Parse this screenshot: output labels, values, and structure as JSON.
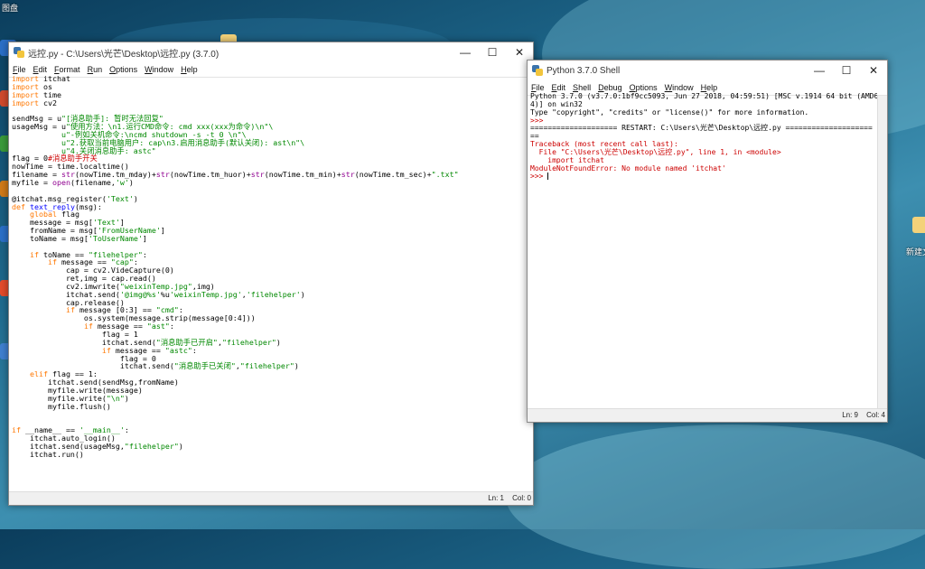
{
  "editor": {
    "title": "远控.py - C:\\Users\\光芒\\Desktop\\远控.py (3.7.0)",
    "menu": [
      "File",
      "Edit",
      "Format",
      "Run",
      "Options",
      "Window",
      "Help"
    ],
    "status_line": "Ln: 1",
    "status_col": "Col: 0",
    "code_lines": [
      [
        [
          "kw",
          "import"
        ],
        [
          "",
          " itchat"
        ]
      ],
      [
        [
          "kw",
          "import"
        ],
        [
          "",
          " os"
        ]
      ],
      [
        [
          "kw",
          "import"
        ],
        [
          "",
          " time"
        ]
      ],
      [
        [
          "kw",
          "import"
        ],
        [
          "",
          " cv2"
        ]
      ],
      [
        [
          "",
          ""
        ]
      ],
      [
        [
          "",
          "sendMsg = u"
        ],
        [
          "st",
          "\"[消息助手]: 暂时无法回复\""
        ]
      ],
      [
        [
          "",
          "usageMsg = u"
        ],
        [
          "st",
          "\"使用方法：\\n1.运行CMD命令: cmd xxx(xxx为命令)\\n\"\\"
        ]
      ],
      [
        [
          "st",
          "           u\"-例如关机命令:\\ncmd shutdown -s -t 0 \\n\"\\"
        ]
      ],
      [
        [
          "st",
          "           u\"2.获取当前电脑用户: cap\\n3.启用消息助手(默认关闭): ast\\n\"\\"
        ]
      ],
      [
        [
          "st",
          "           u\"4.关闭消息助手: astc\""
        ]
      ],
      [
        [
          "",
          "flag = 0"
        ],
        [
          "er",
          "#消息助手开关"
        ]
      ],
      [
        [
          "",
          "nowTime = time.localtime()"
        ]
      ],
      [
        [
          "",
          "filename = "
        ],
        [
          "bi",
          "str"
        ],
        [
          "",
          "(nowTime.tm_mday)+"
        ],
        [
          "bi",
          "str"
        ],
        [
          "",
          "(nowTime.tm_huor)+"
        ],
        [
          "bi",
          "str"
        ],
        [
          "",
          "(nowTime.tm_min)+"
        ],
        [
          "bi",
          "str"
        ],
        [
          "",
          "(nowTime.tm_sec)+"
        ],
        [
          "st",
          "\".txt\""
        ]
      ],
      [
        [
          "",
          "myfile = "
        ],
        [
          "bi",
          "open"
        ],
        [
          "",
          "(filename,"
        ],
        [
          "st",
          "'w'"
        ],
        [
          "",
          ")"
        ]
      ],
      [
        [
          "",
          ""
        ]
      ],
      [
        [
          "",
          "@itchat.msg_register("
        ],
        [
          "st",
          "'Text'"
        ],
        [
          "",
          ")"
        ]
      ],
      [
        [
          "kw",
          "def"
        ],
        [
          "",
          " "
        ],
        [
          "fn",
          "text_reply"
        ],
        [
          "",
          "(msg):"
        ]
      ],
      [
        [
          "",
          "    "
        ],
        [
          "kw",
          "global"
        ],
        [
          "",
          " flag"
        ]
      ],
      [
        [
          "",
          "    message = msg["
        ],
        [
          "st",
          "'Text'"
        ],
        [
          "",
          "]"
        ]
      ],
      [
        [
          "",
          "    fromName = msg["
        ],
        [
          "st",
          "'FromUserName'"
        ],
        [
          "",
          "]"
        ]
      ],
      [
        [
          "",
          "    toName = msg["
        ],
        [
          "st",
          "'ToUserName'"
        ],
        [
          "",
          "]"
        ]
      ],
      [
        [
          "",
          ""
        ]
      ],
      [
        [
          "",
          "    "
        ],
        [
          "kw",
          "if"
        ],
        [
          "",
          " toName == "
        ],
        [
          "st",
          "\"filehelper\""
        ],
        [
          "",
          ":"
        ]
      ],
      [
        [
          "",
          "        "
        ],
        [
          "kw",
          "if"
        ],
        [
          "",
          " message == "
        ],
        [
          "st",
          "\"cap\""
        ],
        [
          "",
          ":"
        ]
      ],
      [
        [
          "",
          "            cap = cv2.VideCapture(0)"
        ]
      ],
      [
        [
          "",
          "            ret,img = cap.read()"
        ]
      ],
      [
        [
          "",
          "            cv2.imwrite("
        ],
        [
          "st",
          "\"weixinTemp.jpg\""
        ],
        [
          "",
          ",img)"
        ]
      ],
      [
        [
          "",
          "            itchat.send("
        ],
        [
          "st",
          "'@img@%s'"
        ],
        [
          "",
          "%u"
        ],
        [
          "st",
          "'weixinTemp.jpg'"
        ],
        [
          "",
          ","
        ],
        [
          "st",
          "'filehelper'"
        ],
        [
          "",
          ")"
        ]
      ],
      [
        [
          "",
          "            cap.release()"
        ]
      ],
      [
        [
          "",
          "            "
        ],
        [
          "kw",
          "if"
        ],
        [
          "",
          " message [0:3] == "
        ],
        [
          "st",
          "\"cmd\""
        ],
        [
          "",
          ":"
        ]
      ],
      [
        [
          "",
          "                os.system(message.strip(message[0:4]))"
        ]
      ],
      [
        [
          "",
          "                "
        ],
        [
          "kw",
          "if"
        ],
        [
          "",
          " message == "
        ],
        [
          "st",
          "\"ast\""
        ],
        [
          "",
          ":"
        ]
      ],
      [
        [
          "",
          "                    flag = 1"
        ]
      ],
      [
        [
          "",
          "                    itchat.send("
        ],
        [
          "st",
          "\"消息助手已开启\""
        ],
        [
          "",
          ","
        ],
        [
          "st",
          "\"filehelper\""
        ],
        [
          "",
          ")"
        ]
      ],
      [
        [
          "",
          "                    "
        ],
        [
          "kw",
          "if"
        ],
        [
          "",
          " message == "
        ],
        [
          "st",
          "\"astc\""
        ],
        [
          "",
          ":"
        ]
      ],
      [
        [
          "",
          "                        flag = 0"
        ]
      ],
      [
        [
          "",
          "                        itchat.send("
        ],
        [
          "st",
          "\"消息助手已关闭\""
        ],
        [
          "",
          ","
        ],
        [
          "st",
          "\"filehelper\""
        ],
        [
          "",
          ")"
        ]
      ],
      [
        [
          "",
          "    "
        ],
        [
          "kw",
          "elif"
        ],
        [
          "",
          " flag == 1:"
        ]
      ],
      [
        [
          "",
          "        itchat.send(sendMsg,fromName)"
        ]
      ],
      [
        [
          "",
          "        myfile.write(message)"
        ]
      ],
      [
        [
          "",
          "        myfile.write("
        ],
        [
          "st",
          "\"\\n\""
        ],
        [
          "",
          ")"
        ]
      ],
      [
        [
          "",
          "        myfile.flush()"
        ]
      ],
      [
        [
          "",
          ""
        ]
      ],
      [
        [
          "",
          ""
        ]
      ],
      [
        [
          "kw",
          "if"
        ],
        [
          "",
          " __name__ == "
        ],
        [
          "st",
          "'__main__'"
        ],
        [
          "",
          ":"
        ]
      ],
      [
        [
          "",
          "    itchat.auto_login()"
        ]
      ],
      [
        [
          "",
          "    itchat.send(usageMsg,"
        ],
        [
          "st",
          "\"filehelper\""
        ],
        [
          "",
          ")"
        ]
      ],
      [
        [
          "",
          "    itchat.run()"
        ]
      ]
    ]
  },
  "shell": {
    "title": "Python 3.7.0 Shell",
    "menu": [
      "File",
      "Edit",
      "Shell",
      "Debug",
      "Options",
      "Window",
      "Help"
    ],
    "status_line": "Ln: 9",
    "status_col": "Col: 4",
    "lines": [
      [
        [
          "",
          "Python 3.7.0 (v3.7.0:1bf9cc5093, Jun 27 2018, 04:59:51) [MSC v.1914 64 bit (AMD6"
        ]
      ],
      [
        [
          "",
          "4)] on win32"
        ]
      ],
      [
        [
          "",
          "Type \"copyright\", \"credits\" or \"license()\" for more information."
        ]
      ],
      [
        [
          "er",
          ">>> "
        ]
      ],
      [
        [
          "",
          "==================== RESTART: C:\\Users\\光芒\\Desktop\\远控.py ===================="
        ]
      ],
      [
        [
          "",
          "=="
        ]
      ],
      [
        [
          "er",
          "Traceback (most recent call last):"
        ]
      ],
      [
        [
          "er",
          "  File \"C:\\Users\\光芒\\Desktop\\远控.py\", line 1, in <module>"
        ]
      ],
      [
        [
          "er",
          "    import itchat"
        ]
      ],
      [
        [
          "er",
          "ModuleNotFoundError: No module named 'itchat'"
        ]
      ],
      [
        [
          "er",
          ">>> "
        ],
        [
          "cursor",
          ""
        ]
      ]
    ]
  },
  "desktop": {
    "labels": [
      "图盘",
      "新建文"
    ]
  },
  "colors": {
    "keyword": "#ff7700",
    "string": "#008800",
    "builtin": "#900090",
    "error": "#cc0000"
  }
}
